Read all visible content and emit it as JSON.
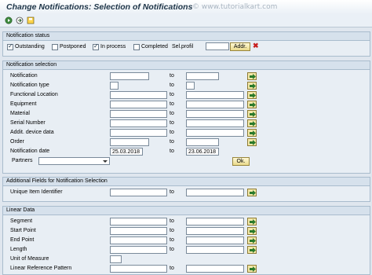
{
  "window": {
    "title": "Change Notifications: Selection of Notifications"
  },
  "watermark": "© www.tutorialkart.com",
  "toolbar": {
    "icons": [
      "execute-icon",
      "get-variant-icon",
      "save-variant-icon"
    ]
  },
  "status": {
    "header": "Notification status",
    "checkboxes": [
      {
        "label": "Outstanding",
        "checked": true
      },
      {
        "label": "Postponed",
        "checked": false
      },
      {
        "label": "In process",
        "checked": true
      },
      {
        "label": "Completed",
        "checked": false
      }
    ],
    "sel_profil_label": "Sel.profil",
    "sel_profil_value": "",
    "addr_button": "Addr."
  },
  "selection": {
    "header": "Notification selection",
    "to_label": "to",
    "rows": [
      {
        "label": "Notification",
        "from": "",
        "to": ""
      },
      {
        "label": "Notification type",
        "from": "",
        "to": ""
      },
      {
        "label": "Functional Location",
        "from": "",
        "to": ""
      },
      {
        "label": "Equipment",
        "from": "",
        "to": ""
      },
      {
        "label": "Material",
        "from": "",
        "to": ""
      },
      {
        "label": "Serial Number",
        "from": "",
        "to": ""
      },
      {
        "label": "Addit. device data",
        "from": "",
        "to": ""
      },
      {
        "label": "Order",
        "from": "",
        "to": ""
      },
      {
        "label": "Notification date",
        "from": "25.03.2018",
        "to": "23.06.2018"
      }
    ],
    "partners_label": "Partners",
    "partners_value": "",
    "ok_button": "Ok."
  },
  "additional": {
    "header": "Additional Fields for Notification Selection",
    "rows": [
      {
        "label": "Unique Item Identifier",
        "from": "",
        "to": ""
      }
    ]
  },
  "linear": {
    "header": "Linear Data",
    "rows": [
      {
        "label": "Segment",
        "from": "",
        "to": ""
      },
      {
        "label": "Start Point",
        "from": "",
        "to": ""
      },
      {
        "label": "End Point",
        "from": "",
        "to": ""
      },
      {
        "label": "Length",
        "from": "",
        "to": ""
      },
      {
        "label": "Unit of Measure",
        "from": ""
      },
      {
        "label": "Linear Reference Pattern",
        "from": "",
        "to": ""
      }
    ]
  }
}
